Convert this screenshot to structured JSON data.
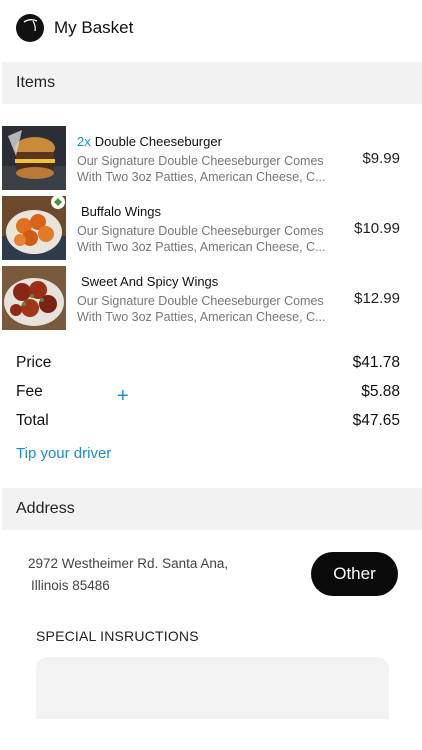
{
  "header": {
    "title": "My Basket",
    "logo_icon": "logo-icon"
  },
  "items_section": {
    "title": "Items"
  },
  "items": [
    {
      "quantity": "2x",
      "name": "Double Cheeseburger",
      "desc_line1": "Our Signature Double Cheeseburger Comes",
      "desc_line2": "With Two 3oz Patties, American Cheese, C...",
      "price": "$9.99",
      "image_icon": "burger-image"
    },
    {
      "quantity": "",
      "name": "Buffalo Wings",
      "desc_line1": "Our Signature Double Cheeseburger Comes",
      "desc_line2": "With Two 3oz Patties, American Cheese, C...",
      "price": "$10.99",
      "image_icon": "wings-image"
    },
    {
      "quantity": "",
      "name": "Sweet And Spicy Wings",
      "desc_line1": "Our Signature Double Cheeseburger Comes",
      "desc_line2": "With Two 3oz Patties, American Cheese, C...",
      "price": "$12.99",
      "image_icon": "spicy-wings-image"
    }
  ],
  "summary": {
    "price_label": "Price",
    "price_value": "$41.78",
    "fee_label": "Fee",
    "fee_value": "$5.88",
    "total_label": "Total",
    "total_value": "$47.65",
    "tip_label": "Tip your driver",
    "plus_icon": "plus-icon"
  },
  "address_section": {
    "title": "Address",
    "line1": "2972 Westheimer Rd. Santa Ana,",
    "line2": "Illinois 85486",
    "button_label": "Other"
  },
  "instructions": {
    "label": "SPECIAL INSRUCTIONS",
    "value": ""
  },
  "colors": {
    "accent": "#1a8fc9",
    "section_bg": "#f2f2f2",
    "button_bg": "#0a0a0a",
    "muted_text": "#777777"
  }
}
